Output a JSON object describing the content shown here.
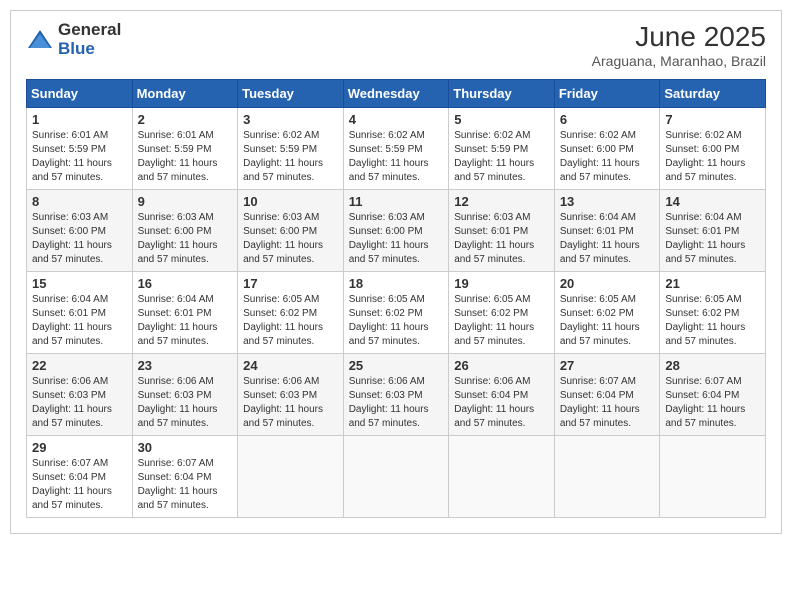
{
  "logo": {
    "general": "General",
    "blue": "Blue"
  },
  "header": {
    "month_year": "June 2025",
    "location": "Araguana, Maranhao, Brazil"
  },
  "days_of_week": [
    "Sunday",
    "Monday",
    "Tuesday",
    "Wednesday",
    "Thursday",
    "Friday",
    "Saturday"
  ],
  "weeks": [
    [
      {
        "day": "1",
        "sunrise": "6:01 AM",
        "sunset": "5:59 PM",
        "daylight": "11 hours and 57 minutes."
      },
      {
        "day": "2",
        "sunrise": "6:01 AM",
        "sunset": "5:59 PM",
        "daylight": "11 hours and 57 minutes."
      },
      {
        "day": "3",
        "sunrise": "6:02 AM",
        "sunset": "5:59 PM",
        "daylight": "11 hours and 57 minutes."
      },
      {
        "day": "4",
        "sunrise": "6:02 AM",
        "sunset": "5:59 PM",
        "daylight": "11 hours and 57 minutes."
      },
      {
        "day": "5",
        "sunrise": "6:02 AM",
        "sunset": "5:59 PM",
        "daylight": "11 hours and 57 minutes."
      },
      {
        "day": "6",
        "sunrise": "6:02 AM",
        "sunset": "6:00 PM",
        "daylight": "11 hours and 57 minutes."
      },
      {
        "day": "7",
        "sunrise": "6:02 AM",
        "sunset": "6:00 PM",
        "daylight": "11 hours and 57 minutes."
      }
    ],
    [
      {
        "day": "8",
        "sunrise": "6:03 AM",
        "sunset": "6:00 PM",
        "daylight": "11 hours and 57 minutes."
      },
      {
        "day": "9",
        "sunrise": "6:03 AM",
        "sunset": "6:00 PM",
        "daylight": "11 hours and 57 minutes."
      },
      {
        "day": "10",
        "sunrise": "6:03 AM",
        "sunset": "6:00 PM",
        "daylight": "11 hours and 57 minutes."
      },
      {
        "day": "11",
        "sunrise": "6:03 AM",
        "sunset": "6:00 PM",
        "daylight": "11 hours and 57 minutes."
      },
      {
        "day": "12",
        "sunrise": "6:03 AM",
        "sunset": "6:01 PM",
        "daylight": "11 hours and 57 minutes."
      },
      {
        "day": "13",
        "sunrise": "6:04 AM",
        "sunset": "6:01 PM",
        "daylight": "11 hours and 57 minutes."
      },
      {
        "day": "14",
        "sunrise": "6:04 AM",
        "sunset": "6:01 PM",
        "daylight": "11 hours and 57 minutes."
      }
    ],
    [
      {
        "day": "15",
        "sunrise": "6:04 AM",
        "sunset": "6:01 PM",
        "daylight": "11 hours and 57 minutes."
      },
      {
        "day": "16",
        "sunrise": "6:04 AM",
        "sunset": "6:01 PM",
        "daylight": "11 hours and 57 minutes."
      },
      {
        "day": "17",
        "sunrise": "6:05 AM",
        "sunset": "6:02 PM",
        "daylight": "11 hours and 57 minutes."
      },
      {
        "day": "18",
        "sunrise": "6:05 AM",
        "sunset": "6:02 PM",
        "daylight": "11 hours and 57 minutes."
      },
      {
        "day": "19",
        "sunrise": "6:05 AM",
        "sunset": "6:02 PM",
        "daylight": "11 hours and 57 minutes."
      },
      {
        "day": "20",
        "sunrise": "6:05 AM",
        "sunset": "6:02 PM",
        "daylight": "11 hours and 57 minutes."
      },
      {
        "day": "21",
        "sunrise": "6:05 AM",
        "sunset": "6:02 PM",
        "daylight": "11 hours and 57 minutes."
      }
    ],
    [
      {
        "day": "22",
        "sunrise": "6:06 AM",
        "sunset": "6:03 PM",
        "daylight": "11 hours and 57 minutes."
      },
      {
        "day": "23",
        "sunrise": "6:06 AM",
        "sunset": "6:03 PM",
        "daylight": "11 hours and 57 minutes."
      },
      {
        "day": "24",
        "sunrise": "6:06 AM",
        "sunset": "6:03 PM",
        "daylight": "11 hours and 57 minutes."
      },
      {
        "day": "25",
        "sunrise": "6:06 AM",
        "sunset": "6:03 PM",
        "daylight": "11 hours and 57 minutes."
      },
      {
        "day": "26",
        "sunrise": "6:06 AM",
        "sunset": "6:04 PM",
        "daylight": "11 hours and 57 minutes."
      },
      {
        "day": "27",
        "sunrise": "6:07 AM",
        "sunset": "6:04 PM",
        "daylight": "11 hours and 57 minutes."
      },
      {
        "day": "28",
        "sunrise": "6:07 AM",
        "sunset": "6:04 PM",
        "daylight": "11 hours and 57 minutes."
      }
    ],
    [
      {
        "day": "29",
        "sunrise": "6:07 AM",
        "sunset": "6:04 PM",
        "daylight": "11 hours and 57 minutes."
      },
      {
        "day": "30",
        "sunrise": "6:07 AM",
        "sunset": "6:04 PM",
        "daylight": "11 hours and 57 minutes."
      },
      null,
      null,
      null,
      null,
      null
    ]
  ],
  "labels": {
    "sunrise": "Sunrise: ",
    "sunset": "Sunset: ",
    "daylight": "Daylight: "
  }
}
